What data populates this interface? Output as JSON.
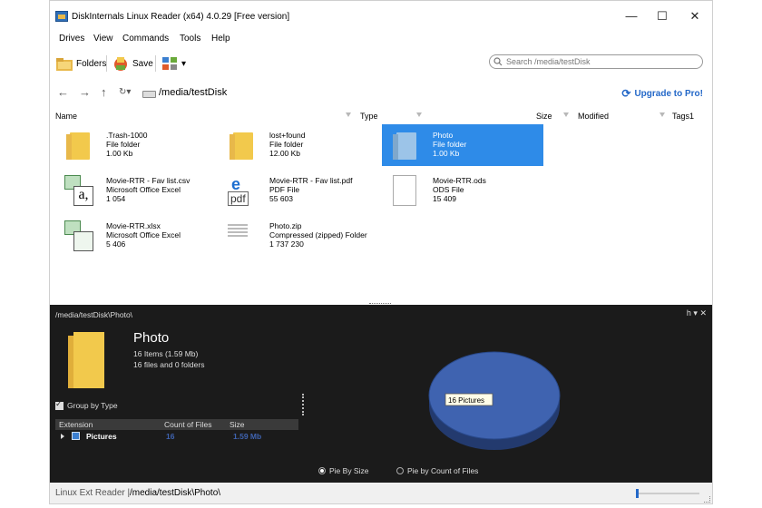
{
  "window": {
    "title": "DiskInternals Linux Reader (x64) 4.0.29 [Free version]"
  },
  "window_controls": {
    "minimize": "—",
    "maximize": "☐",
    "close": "✕"
  },
  "menu": [
    "Drives",
    "View",
    "Commands",
    "Tools",
    "Help"
  ],
  "toolbar": {
    "folders_label": "Folders",
    "save_label": "Save",
    "view_arrow": "▾"
  },
  "search": {
    "placeholder": "Search /media/testDisk"
  },
  "nav": {
    "back": "←",
    "forward": "→",
    "up": "↑",
    "history": "↻▾",
    "path": "/media/testDisk",
    "upgrade": "Upgrade to Pro!",
    "upgrade_icon": "⟳"
  },
  "columns": {
    "name": "Name",
    "type": "Type",
    "size": "Size",
    "modified": "Modified",
    "tags": "Tags1"
  },
  "files": [
    {
      "name": ".Trash-1000",
      "type": "File folder",
      "size": "1.00 Kb",
      "icon": "folder-icon",
      "selected": false
    },
    {
      "name": "lost+found",
      "type": "File folder",
      "size": "12.00 Kb",
      "icon": "folder-icon",
      "selected": false
    },
    {
      "name": "Photo",
      "type": "File folder",
      "size": "1.00 Kb",
      "icon": "folder-icon",
      "selected": true
    },
    {
      "name": "Movie-RTR - Fav list.csv",
      "type": "Microsoft Office Excel",
      "size": "1 054",
      "icon": "excel-csv-icon",
      "selected": false
    },
    {
      "name": "Movie-RTR - Fav list.pdf",
      "type": "PDF File",
      "size": "55 603",
      "icon": "pdf-icon",
      "selected": false
    },
    {
      "name": "Movie-RTR.ods",
      "type": "ODS File",
      "size": "15 409",
      "icon": "document-icon",
      "selected": false
    },
    {
      "name": "Movie-RTR.xlsx",
      "type": "Microsoft Office Excel",
      "size": "5 406",
      "icon": "excel-icon",
      "selected": false
    },
    {
      "name": "Photo.zip",
      "type": "Compressed (zipped) Folder",
      "size": "1 737 230",
      "icon": "zip-icon",
      "selected": false
    }
  ],
  "icon_glyphs": {
    "excel_letter": "a,",
    "pdf_letter": "e",
    "pdf_text": "pdf"
  },
  "panel": {
    "path": "/media/testDisk\\Photo\\",
    "controls": "h ▾ ✕",
    "title": "Photo",
    "items": "16 Items (1.59 Mb)",
    "files_folders": "16 files and 0 folders",
    "group_by": "Group by Type",
    "table_headers": {
      "extension": "Extension",
      "count": "Count of Files",
      "size": "Size"
    },
    "table_rows": [
      {
        "extension": "Pictures",
        "count": "16",
        "size": "1.59 Mb"
      }
    ],
    "pie_label": "16 Pictures",
    "radio_size": "Pie By Size",
    "radio_count": "Pie by Count of Files",
    "radio_selected": "size",
    "accent": "#3f63b0"
  },
  "status": {
    "left": "Linux Ext Reader |",
    "path": "/media/testDisk\\Photo\\"
  }
}
